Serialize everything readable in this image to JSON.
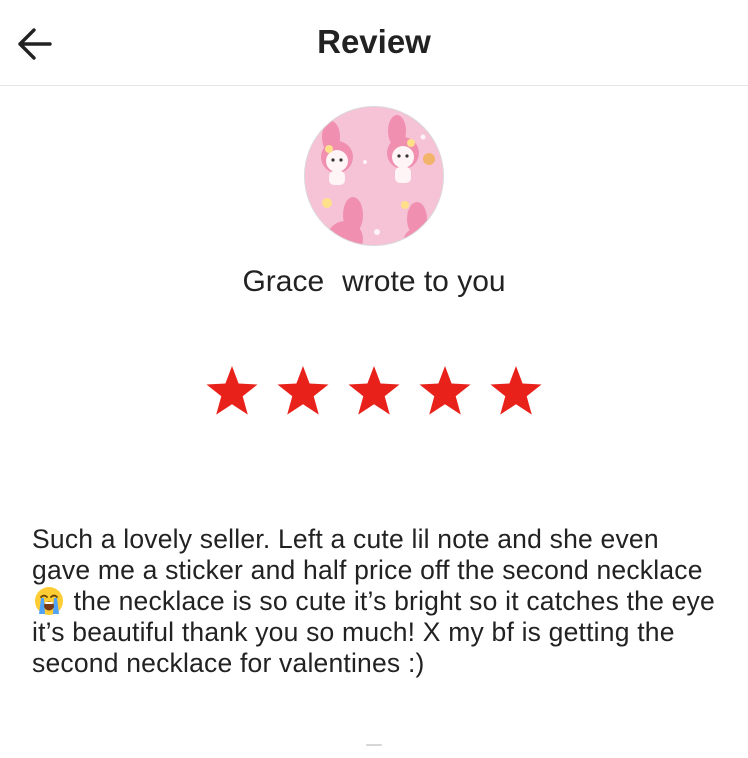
{
  "header": {
    "title": "Review",
    "back_icon": "arrow-left-icon"
  },
  "reviewer": {
    "name": "Grace",
    "action_text": "wrote to you",
    "avatar_icon": "avatar-image"
  },
  "rating": {
    "value": 5,
    "max": 5,
    "star_color": "#e8221b"
  },
  "review": {
    "text_part1": "Such a lovely seller. Left a cute lil note and she even gave me a sticker and half price off the second necklace",
    "emoji": "loudly-crying-face-emoji",
    "text_part2": "the necklace is so cute it’s bright so it catches the eye it’s beautiful thank you so much! X my bf is getting the second necklace for valentines :)"
  }
}
